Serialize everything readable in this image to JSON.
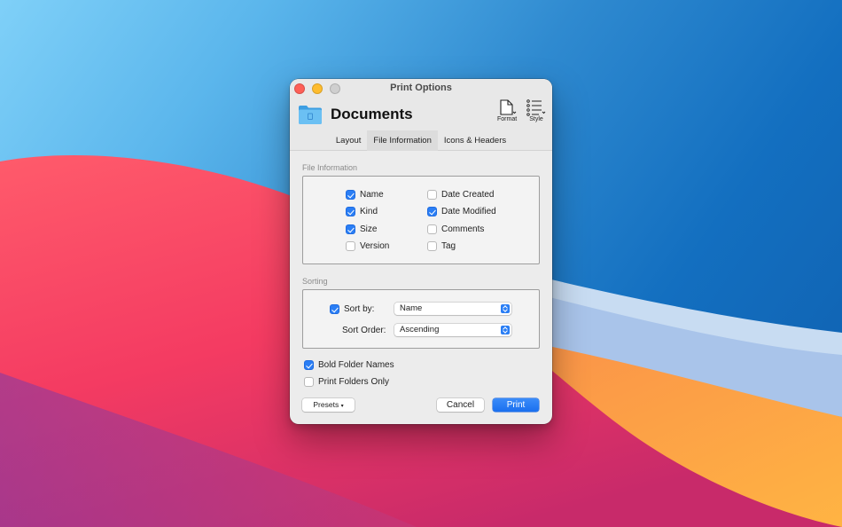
{
  "window": {
    "title": "Print Options",
    "document_title": "Documents"
  },
  "toolbar": {
    "format_label": "Format",
    "style_label": "Style"
  },
  "tabs": [
    {
      "label": "Layout",
      "active": false
    },
    {
      "label": "File Information",
      "active": true
    },
    {
      "label": "Icons & Headers",
      "active": false
    }
  ],
  "file_information": {
    "section_label": "File Information",
    "options": [
      {
        "label": "Name",
        "checked": true
      },
      {
        "label": "Kind",
        "checked": true
      },
      {
        "label": "Size",
        "checked": true
      },
      {
        "label": "Version",
        "checked": false
      },
      {
        "label": "Date Created",
        "checked": false
      },
      {
        "label": "Date Modified",
        "checked": true
      },
      {
        "label": "Comments",
        "checked": false
      },
      {
        "label": "Tag",
        "checked": false
      }
    ]
  },
  "sorting": {
    "section_label": "Sorting",
    "sort_by_label": "Sort by:",
    "sort_by_checked": true,
    "sort_by_value": "Name",
    "sort_order_label": "Sort Order:",
    "sort_order_value": "Ascending"
  },
  "extra_options": [
    {
      "label": "Bold Folder Names",
      "checked": true
    },
    {
      "label": "Print Folders Only",
      "checked": false
    }
  ],
  "buttons": {
    "presets": "Presets",
    "cancel": "Cancel",
    "print": "Print"
  },
  "colors": {
    "accent": "#2a7ef5",
    "close": "#fe5f57",
    "minimize": "#febc2e"
  }
}
